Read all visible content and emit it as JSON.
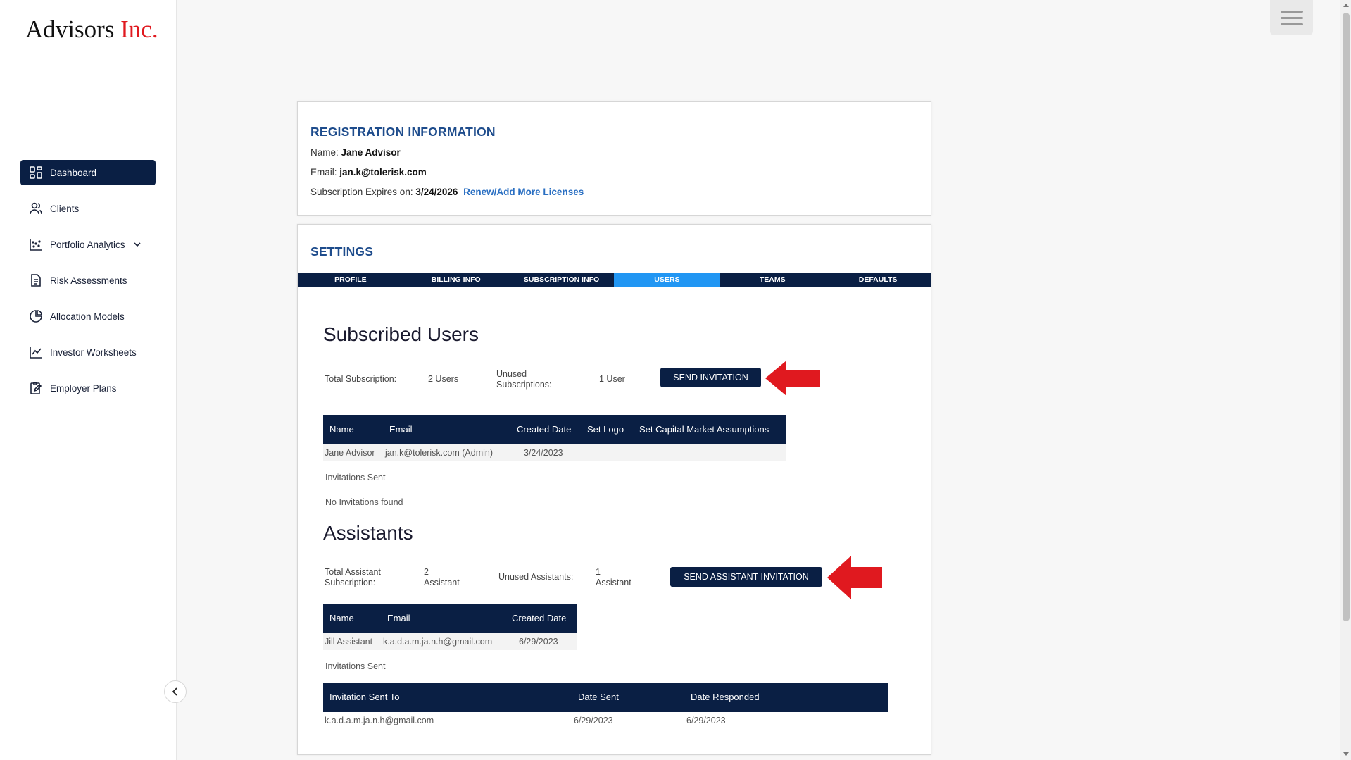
{
  "brand": {
    "name": "Advisors ",
    "suffix": "Inc."
  },
  "nav": [
    {
      "label": "Dashboard"
    },
    {
      "label": "Clients"
    },
    {
      "label": "Portfolio Analytics"
    },
    {
      "label": "Risk Assessments"
    },
    {
      "label": "Allocation Models"
    },
    {
      "label": "Investor Worksheets"
    },
    {
      "label": "Employer Plans"
    }
  ],
  "registration": {
    "title": "REGISTRATION INFORMATION",
    "name_label": "Name:",
    "name_value": "Jane Advisor",
    "email_label": "Email:",
    "email_value": "jan.k@tolerisk.com",
    "expires_label": "Subscription Expires on:",
    "expires_value": "3/24/2026",
    "renew_link": "Renew/Add More Licenses"
  },
  "settings": {
    "title": "SETTINGS",
    "tabs": [
      "PROFILE",
      "BILLING INFO",
      "SUBSCRIPTION INFO",
      "USERS",
      "TEAMS",
      "DEFAULTS"
    ],
    "active_tab": "USERS"
  },
  "subscribed_users": {
    "title": "Subscribed Users",
    "total_label": "Total Subscription:",
    "total_value": "2 Users",
    "unused_label_1": "Unused",
    "unused_label_2": "Subscriptions:",
    "unused_value": "1 User",
    "button": "SEND INVITATION",
    "columns": [
      "Name",
      "Email",
      "Created Date",
      "Set Logo",
      "Set Capital Market Assumptions"
    ],
    "rows": [
      {
        "name": "Jane Advisor",
        "email": "jan.k@tolerisk.com (Admin)",
        "created": "3/24/2023"
      }
    ],
    "invitations_label": "Invitations Sent",
    "no_invitations": "No Invitations found"
  },
  "assistants": {
    "title": "Assistants",
    "total_label_1": "Total Assistant",
    "total_label_2": "Subscription:",
    "total_value_1": "2",
    "total_value_2": "Assistant",
    "unused_label": "Unused Assistants:",
    "unused_value_1": "1",
    "unused_value_2": "Assistant",
    "button": "SEND ASSISTANT INVITATION",
    "columns": [
      "Name",
      "Email",
      "Created Date"
    ],
    "rows": [
      {
        "name": "Jill Assistant",
        "email": "k.a.d.a.m.ja.n.h@gmail.com",
        "created": "6/29/2023"
      }
    ],
    "invitations_label": "Invitations Sent",
    "inv_columns": [
      "Invitation Sent To",
      "Date Sent",
      "Date Responded"
    ],
    "inv_rows": [
      {
        "to": "k.a.d.a.m.ja.n.h@gmail.com",
        "sent": "6/29/2023",
        "responded": "6/29/2023"
      }
    ]
  },
  "colors": {
    "primary": "#0a1f44",
    "accent": "#2196f3",
    "title_blue": "#1e4c8c",
    "arrow_red": "#e0191f"
  }
}
